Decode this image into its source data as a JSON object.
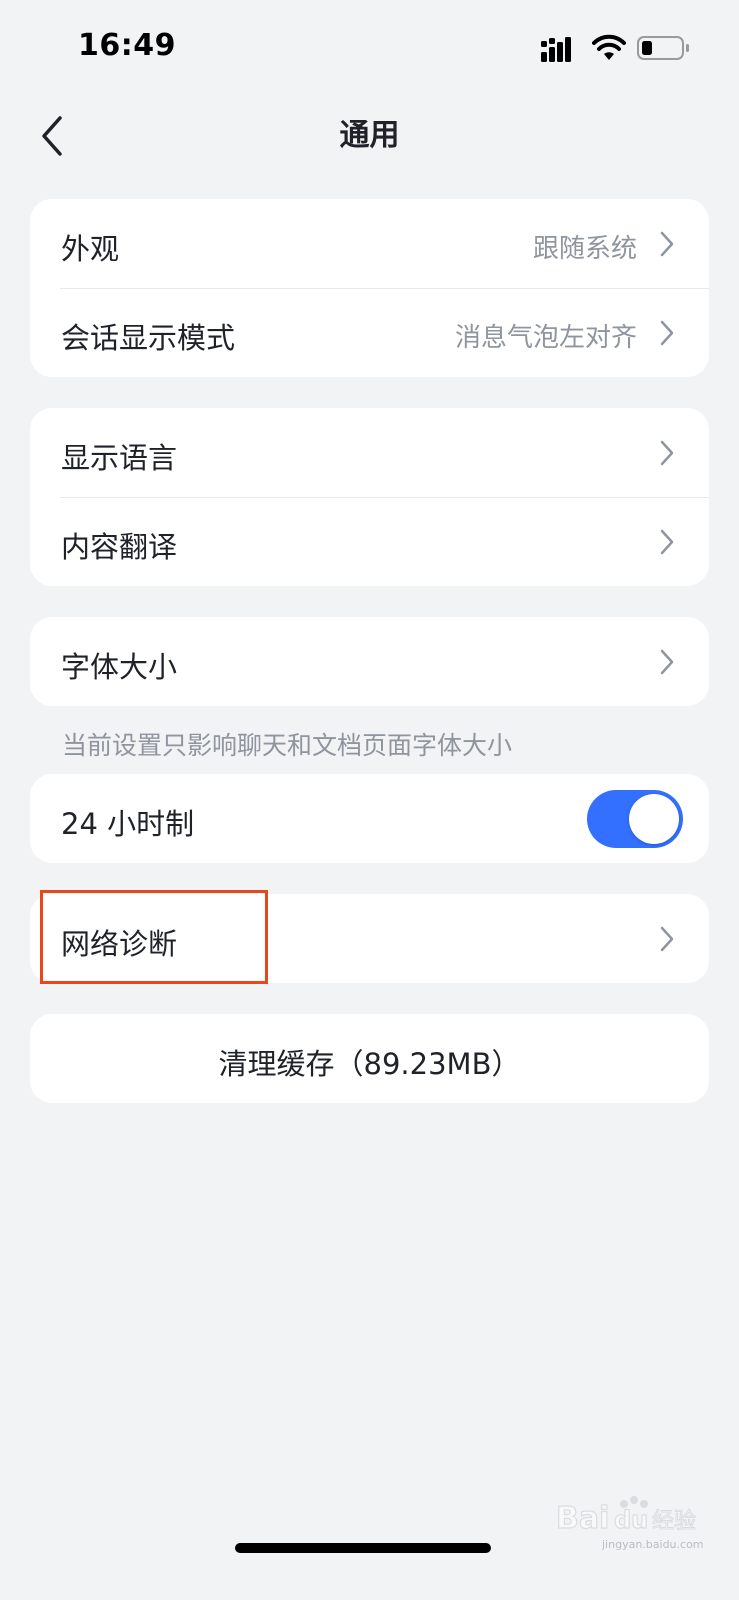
{
  "status_bar": {
    "time": "16:49"
  },
  "nav": {
    "title": "通用",
    "back_icon": "chevron-left-icon"
  },
  "sections": {
    "display": {
      "rows": [
        {
          "label": "外观",
          "value": "跟随系统"
        },
        {
          "label": "会话显示模式",
          "value": "消息气泡左对齐"
        }
      ]
    },
    "language": {
      "rows": [
        {
          "label": "显示语言"
        },
        {
          "label": "内容翻译"
        }
      ]
    },
    "font": {
      "label": "字体大小",
      "helper": "当前设置只影响聊天和文档页面字体大小"
    },
    "time_format": {
      "label": "24 小时制",
      "enabled": true
    },
    "network": {
      "label": "网络诊断"
    },
    "cache": {
      "label": "清理缓存（89.23MB）"
    }
  },
  "colors": {
    "accent": "#3370ff",
    "highlight": "#e8471c",
    "background": "#f2f3f5"
  },
  "watermark": {
    "brand": "Bai du 经验",
    "sub": "jingyan.baidu.com"
  }
}
